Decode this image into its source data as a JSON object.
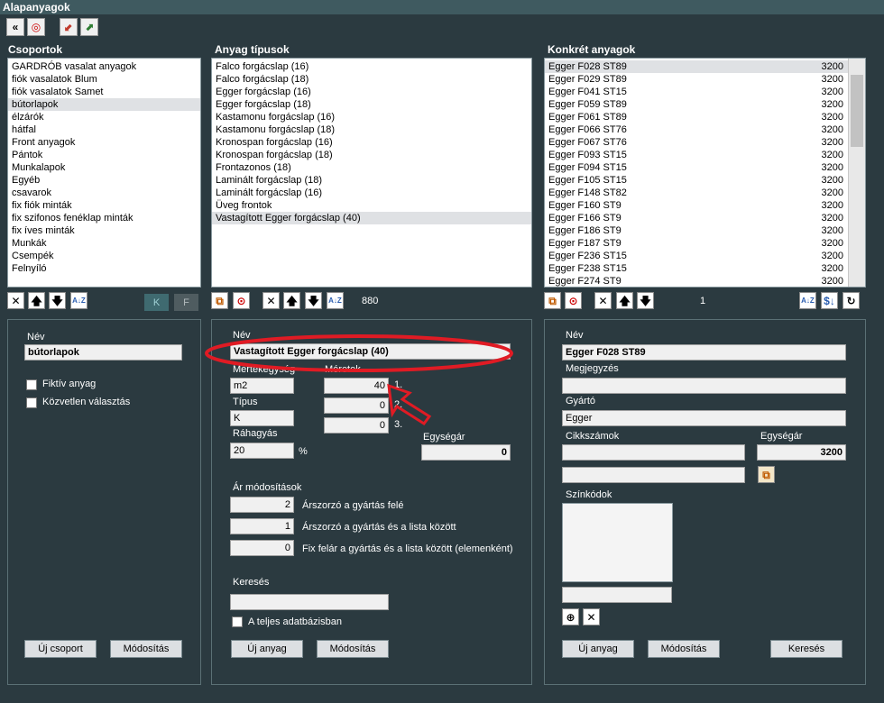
{
  "window": {
    "title": "Alapanyagok"
  },
  "toolbar": {
    "icons": [
      "double-chevron-left-icon",
      "lifebuoy-icon",
      "import-icon",
      "export-icon"
    ],
    "back_glyph": "«",
    "help_glyph": "◎",
    "import_glyph": "⬋",
    "export_glyph": "⬈"
  },
  "groups": {
    "title": "Csoportok",
    "items": [
      "GARDRÓB vasalat anyagok",
      "fiók vasalatok Blum",
      "fiók vasalatok Samet",
      "bútorlapok",
      "élzárók",
      "hátfal",
      "Front anyagok",
      "Pántok",
      "Munkalapok",
      "Egyéb",
      "csavarok",
      "fix fiók minták",
      "fix szifonos fenéklap minták",
      "fix íves minták",
      "Munkák",
      "Csempék",
      "Felnyíló"
    ],
    "selected_index": 3,
    "k_label": "K",
    "f_label": "F",
    "form": {
      "name_label": "Név",
      "name_value": "bútorlapok",
      "fiktiv_label": "Fiktív anyag",
      "kozvetlen_label": "Közvetlen választás",
      "new_button": "Új csoport",
      "modify_button": "Módosítás"
    }
  },
  "types": {
    "title": "Anyag típusok",
    "items": [
      "Falco forgácslap (16)",
      "Falco forgácslap (18)",
      "Egger forgácslap (16)",
      "Egger forgácslap (18)",
      "Kastamonu forgácslap (16)",
      "Kastamonu forgácslap (18)",
      "Kronospan forgácslap (16)",
      "Kronospan forgácslap (18)",
      "Frontazonos (18)",
      "Laminált forgácslap (18)",
      "Laminált forgácslap (16)",
      "Üveg frontok",
      "Vastagított Egger forgácslap (40)"
    ],
    "selected_index": 12,
    "count": "880",
    "form": {
      "name_label": "Név",
      "name_value": "Vastagított Egger forgácslap (40)",
      "unit_label": "Mértékegység",
      "unit_value": "m2",
      "sizes_label": "Méretek",
      "sizes": [
        {
          "value": "40",
          "idx": "1."
        },
        {
          "value": "0",
          "idx": "2."
        },
        {
          "value": "0",
          "idx": "3."
        }
      ],
      "type_label": "Típus",
      "type_value": "K",
      "rahagyas_label": "Ráhagyás",
      "rahagyas_value": "20",
      "percent": "%",
      "unit_price_label": "Egységár",
      "unit_price_value": "0",
      "price_mod_label": "Ár módosítások",
      "price_mods": [
        {
          "value": "2",
          "label": "Árszorzó a gyártás felé"
        },
        {
          "value": "1",
          "label": "Árszorzó a gyártás és a lista között"
        },
        {
          "value": "0",
          "label": "Fix felár a gyártás és a lista között (elemenként)"
        }
      ],
      "search_label": "Keresés",
      "search_value": "",
      "whole_db_label": "A teljes adatbázisban",
      "new_button": "Új anyag",
      "modify_button": "Módosítás"
    }
  },
  "materials": {
    "title": "Konkrét anyagok",
    "items": [
      {
        "name": "Egger F028 ST89",
        "price": "3200"
      },
      {
        "name": "Egger F029 ST89",
        "price": "3200"
      },
      {
        "name": "Egger F041 ST15",
        "price": "3200"
      },
      {
        "name": "Egger F059 ST89",
        "price": "3200"
      },
      {
        "name": "Egger F061 ST89",
        "price": "3200"
      },
      {
        "name": "Egger F066 ST76",
        "price": "3200"
      },
      {
        "name": "Egger F067 ST76",
        "price": "3200"
      },
      {
        "name": "Egger F093 ST15",
        "price": "3200"
      },
      {
        "name": "Egger F094 ST15",
        "price": "3200"
      },
      {
        "name": "Egger F105 ST15",
        "price": "3200"
      },
      {
        "name": "Egger F148 ST82",
        "price": "3200"
      },
      {
        "name": "Egger F160 ST9",
        "price": "3200"
      },
      {
        "name": "Egger F166 ST9",
        "price": "3200"
      },
      {
        "name": "Egger F186 ST9",
        "price": "3200"
      },
      {
        "name": "Egger F187 ST9",
        "price": "3200"
      },
      {
        "name": "Egger F236 ST15",
        "price": "3200"
      },
      {
        "name": "Egger F238 ST15",
        "price": "3200"
      },
      {
        "name": "Egger F274 ST9",
        "price": "3200"
      }
    ],
    "selected_index": 0,
    "count": "1",
    "form": {
      "name_label": "Név",
      "name_value": "Egger F028 ST89",
      "note_label": "Megjegyzés",
      "note_value": "",
      "maker_label": "Gyártó",
      "maker_value": "Egger",
      "sku_label": "Cikkszámok",
      "sku_value1": "",
      "sku_value2": "",
      "unit_price_label": "Egységár",
      "unit_price_value": "3200",
      "color_label": "Színkódok",
      "color_value": "",
      "search_button": "Keresés",
      "new_button": "Új anyag",
      "modify_button": "Módosítás"
    }
  },
  "colors": {
    "annotation_red": "#e01b24",
    "accent_teal": "#3f6a70"
  }
}
